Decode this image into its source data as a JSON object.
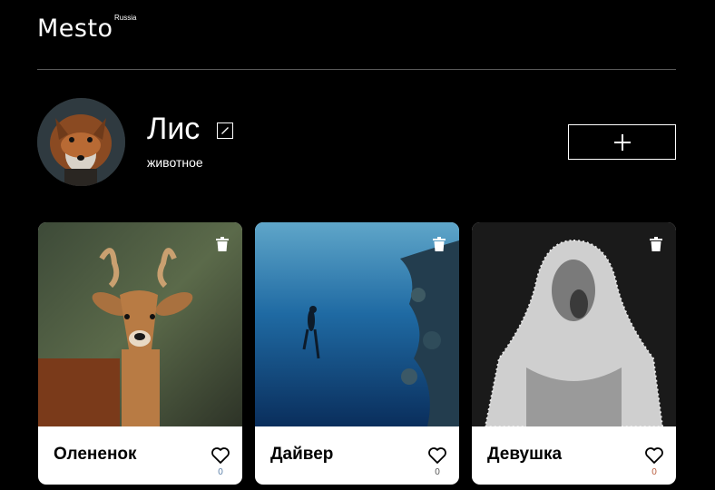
{
  "header": {
    "logo": "Mesto",
    "logo_sub": "Russia"
  },
  "profile": {
    "name": "Лис",
    "about": "животное",
    "edit_icon": "pencil-icon",
    "add_icon": "plus-icon"
  },
  "cards": [
    {
      "title": "Олененок",
      "likes": "0",
      "like_color": "#5a7fa8",
      "image": "deer-photo"
    },
    {
      "title": "Дайвер",
      "likes": "0",
      "like_color": "#555555",
      "image": "diver-photo"
    },
    {
      "title": "Девушка",
      "likes": "0",
      "like_color": "#b85a3a",
      "image": "veiled-woman-photo"
    }
  ],
  "colors": {
    "background": "#000000",
    "card": "#ffffff",
    "divider": "#5a5a5a"
  }
}
